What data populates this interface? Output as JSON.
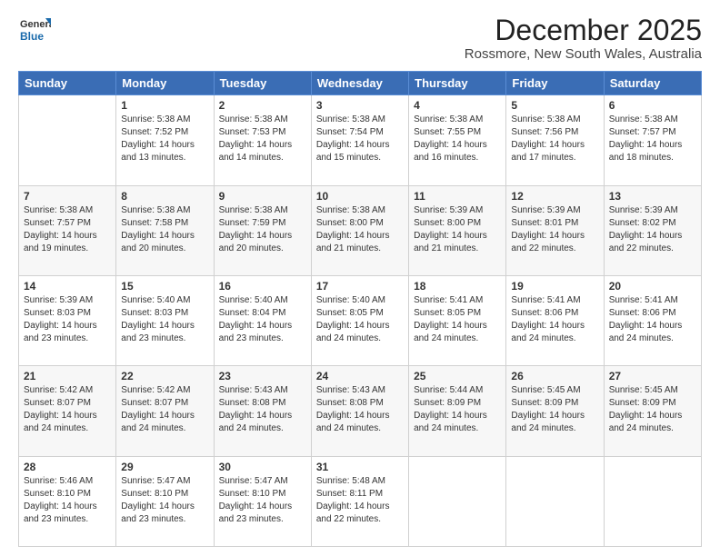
{
  "header": {
    "logo": {
      "line1": "General",
      "line2": "Blue"
    },
    "title": "December 2025",
    "subtitle": "Rossmore, New South Wales, Australia"
  },
  "calendar": {
    "days_of_week": [
      "Sunday",
      "Monday",
      "Tuesday",
      "Wednesday",
      "Thursday",
      "Friday",
      "Saturday"
    ],
    "weeks": [
      [
        {
          "day": "",
          "info": ""
        },
        {
          "day": "1",
          "info": "Sunrise: 5:38 AM\nSunset: 7:52 PM\nDaylight: 14 hours\nand 13 minutes."
        },
        {
          "day": "2",
          "info": "Sunrise: 5:38 AM\nSunset: 7:53 PM\nDaylight: 14 hours\nand 14 minutes."
        },
        {
          "day": "3",
          "info": "Sunrise: 5:38 AM\nSunset: 7:54 PM\nDaylight: 14 hours\nand 15 minutes."
        },
        {
          "day": "4",
          "info": "Sunrise: 5:38 AM\nSunset: 7:55 PM\nDaylight: 14 hours\nand 16 minutes."
        },
        {
          "day": "5",
          "info": "Sunrise: 5:38 AM\nSunset: 7:56 PM\nDaylight: 14 hours\nand 17 minutes."
        },
        {
          "day": "6",
          "info": "Sunrise: 5:38 AM\nSunset: 7:57 PM\nDaylight: 14 hours\nand 18 minutes."
        }
      ],
      [
        {
          "day": "7",
          "info": "Sunrise: 5:38 AM\nSunset: 7:57 PM\nDaylight: 14 hours\nand 19 minutes."
        },
        {
          "day": "8",
          "info": "Sunrise: 5:38 AM\nSunset: 7:58 PM\nDaylight: 14 hours\nand 20 minutes."
        },
        {
          "day": "9",
          "info": "Sunrise: 5:38 AM\nSunset: 7:59 PM\nDaylight: 14 hours\nand 20 minutes."
        },
        {
          "day": "10",
          "info": "Sunrise: 5:38 AM\nSunset: 8:00 PM\nDaylight: 14 hours\nand 21 minutes."
        },
        {
          "day": "11",
          "info": "Sunrise: 5:39 AM\nSunset: 8:00 PM\nDaylight: 14 hours\nand 21 minutes."
        },
        {
          "day": "12",
          "info": "Sunrise: 5:39 AM\nSunset: 8:01 PM\nDaylight: 14 hours\nand 22 minutes."
        },
        {
          "day": "13",
          "info": "Sunrise: 5:39 AM\nSunset: 8:02 PM\nDaylight: 14 hours\nand 22 minutes."
        }
      ],
      [
        {
          "day": "14",
          "info": "Sunrise: 5:39 AM\nSunset: 8:03 PM\nDaylight: 14 hours\nand 23 minutes."
        },
        {
          "day": "15",
          "info": "Sunrise: 5:40 AM\nSunset: 8:03 PM\nDaylight: 14 hours\nand 23 minutes."
        },
        {
          "day": "16",
          "info": "Sunrise: 5:40 AM\nSunset: 8:04 PM\nDaylight: 14 hours\nand 23 minutes."
        },
        {
          "day": "17",
          "info": "Sunrise: 5:40 AM\nSunset: 8:05 PM\nDaylight: 14 hours\nand 24 minutes."
        },
        {
          "day": "18",
          "info": "Sunrise: 5:41 AM\nSunset: 8:05 PM\nDaylight: 14 hours\nand 24 minutes."
        },
        {
          "day": "19",
          "info": "Sunrise: 5:41 AM\nSunset: 8:06 PM\nDaylight: 14 hours\nand 24 minutes."
        },
        {
          "day": "20",
          "info": "Sunrise: 5:41 AM\nSunset: 8:06 PM\nDaylight: 14 hours\nand 24 minutes."
        }
      ],
      [
        {
          "day": "21",
          "info": "Sunrise: 5:42 AM\nSunset: 8:07 PM\nDaylight: 14 hours\nand 24 minutes."
        },
        {
          "day": "22",
          "info": "Sunrise: 5:42 AM\nSunset: 8:07 PM\nDaylight: 14 hours\nand 24 minutes."
        },
        {
          "day": "23",
          "info": "Sunrise: 5:43 AM\nSunset: 8:08 PM\nDaylight: 14 hours\nand 24 minutes."
        },
        {
          "day": "24",
          "info": "Sunrise: 5:43 AM\nSunset: 8:08 PM\nDaylight: 14 hours\nand 24 minutes."
        },
        {
          "day": "25",
          "info": "Sunrise: 5:44 AM\nSunset: 8:09 PM\nDaylight: 14 hours\nand 24 minutes."
        },
        {
          "day": "26",
          "info": "Sunrise: 5:45 AM\nSunset: 8:09 PM\nDaylight: 14 hours\nand 24 minutes."
        },
        {
          "day": "27",
          "info": "Sunrise: 5:45 AM\nSunset: 8:09 PM\nDaylight: 14 hours\nand 24 minutes."
        }
      ],
      [
        {
          "day": "28",
          "info": "Sunrise: 5:46 AM\nSunset: 8:10 PM\nDaylight: 14 hours\nand 23 minutes."
        },
        {
          "day": "29",
          "info": "Sunrise: 5:47 AM\nSunset: 8:10 PM\nDaylight: 14 hours\nand 23 minutes."
        },
        {
          "day": "30",
          "info": "Sunrise: 5:47 AM\nSunset: 8:10 PM\nDaylight: 14 hours\nand 23 minutes."
        },
        {
          "day": "31",
          "info": "Sunrise: 5:48 AM\nSunset: 8:11 PM\nDaylight: 14 hours\nand 22 minutes."
        },
        {
          "day": "",
          "info": ""
        },
        {
          "day": "",
          "info": ""
        },
        {
          "day": "",
          "info": ""
        }
      ]
    ]
  }
}
